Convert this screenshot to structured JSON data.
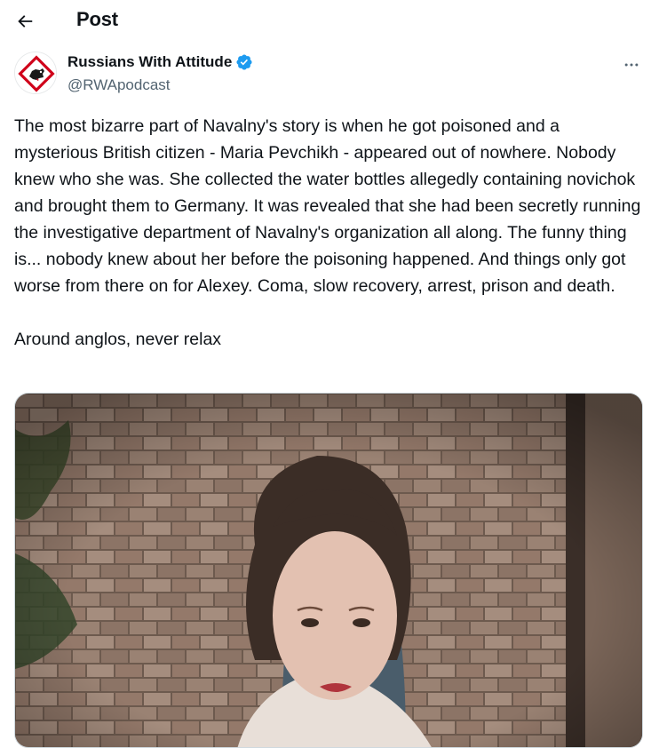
{
  "header": {
    "title": "Post"
  },
  "author": {
    "display_name": "Russians With Attitude",
    "handle": "@RWApodcast",
    "verified": true,
    "verified_color": "#1d9bf0",
    "avatar_accent": "#d0021b"
  },
  "tweet": {
    "text": "The most bizarre part of Navalny's story is when he got poisoned and a mysterious British citizen - Maria Pevchikh - appeared out of nowhere. Nobody knew who she was. She collected the water bottles allegedly containing novichok and brought them to Germany. It was revealed that she had been secretly running the investigative department of Navalny's organization all along. The funny thing is... nobody knew about her before the poisoning happened. And things only got worse from there on for Alexey. Coma, slow recovery, arrest, prison and death.\n\nAround anglos, never relax"
  },
  "icons": {
    "back": "arrow-left-icon",
    "more": "more-horizontal-icon",
    "verified": "verified-badge-icon"
  },
  "colors": {
    "text_primary": "#0f1419",
    "text_secondary": "#536471",
    "border": "#cfd9de"
  }
}
